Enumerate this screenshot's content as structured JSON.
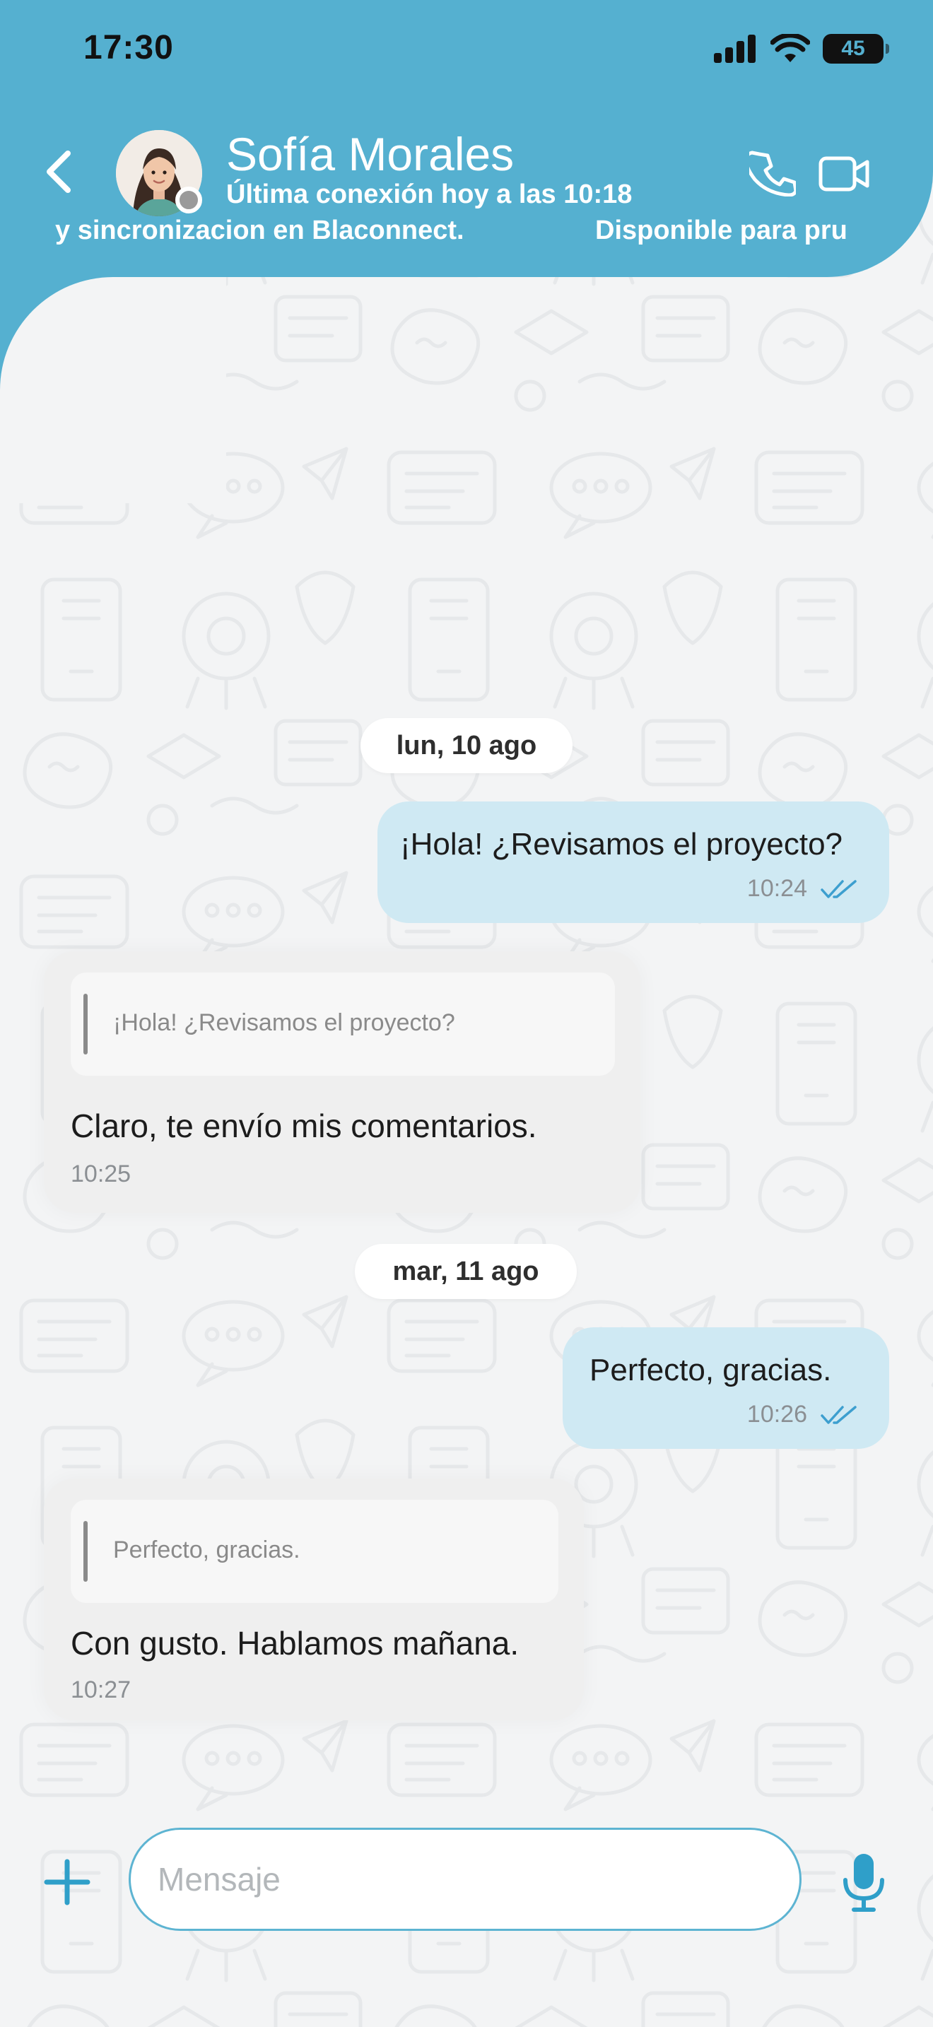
{
  "status_bar": {
    "time": "17:30",
    "battery": "45"
  },
  "header": {
    "contact_name": "Sofía Morales",
    "last_seen": "Última conexión hoy a las 10:18",
    "marquee_segments": [
      "y sincronizacion en Blaconnect.",
      "Disponible para pru"
    ]
  },
  "conversation": {
    "date_chips": [
      "lun, 10 ago",
      "mar, 11 ago"
    ],
    "messages": [
      {
        "direction": "outgoing",
        "text": "¡Hola! ¿Revisamos el proyecto?",
        "time": "10:24"
      },
      {
        "direction": "incoming",
        "quote": "¡Hola! ¿Revisamos el proyecto?",
        "text": "Claro, te envío mis comentarios.",
        "time": "10:25"
      },
      {
        "direction": "outgoing",
        "text": "Perfecto, gracias.",
        "time": "10:26"
      },
      {
        "direction": "incoming",
        "quote": "Perfecto, gracias.",
        "text": "Con gusto. Hablamos mañana.",
        "time": "10:27"
      }
    ]
  },
  "composer": {
    "placeholder": "Mensaje"
  },
  "colors": {
    "header": "#55b0d0",
    "outgoing_bubble": "#cfe9f3",
    "incoming_bubble": "#efefef",
    "accent": "#2f9fc9",
    "background": "#f3f4f5"
  },
  "icons": [
    "back-arrow-icon",
    "phone-icon",
    "video-camera-icon",
    "plus-icon",
    "microphone-icon",
    "double-check-icon",
    "signal-icon",
    "wifi-icon",
    "battery-icon"
  ]
}
